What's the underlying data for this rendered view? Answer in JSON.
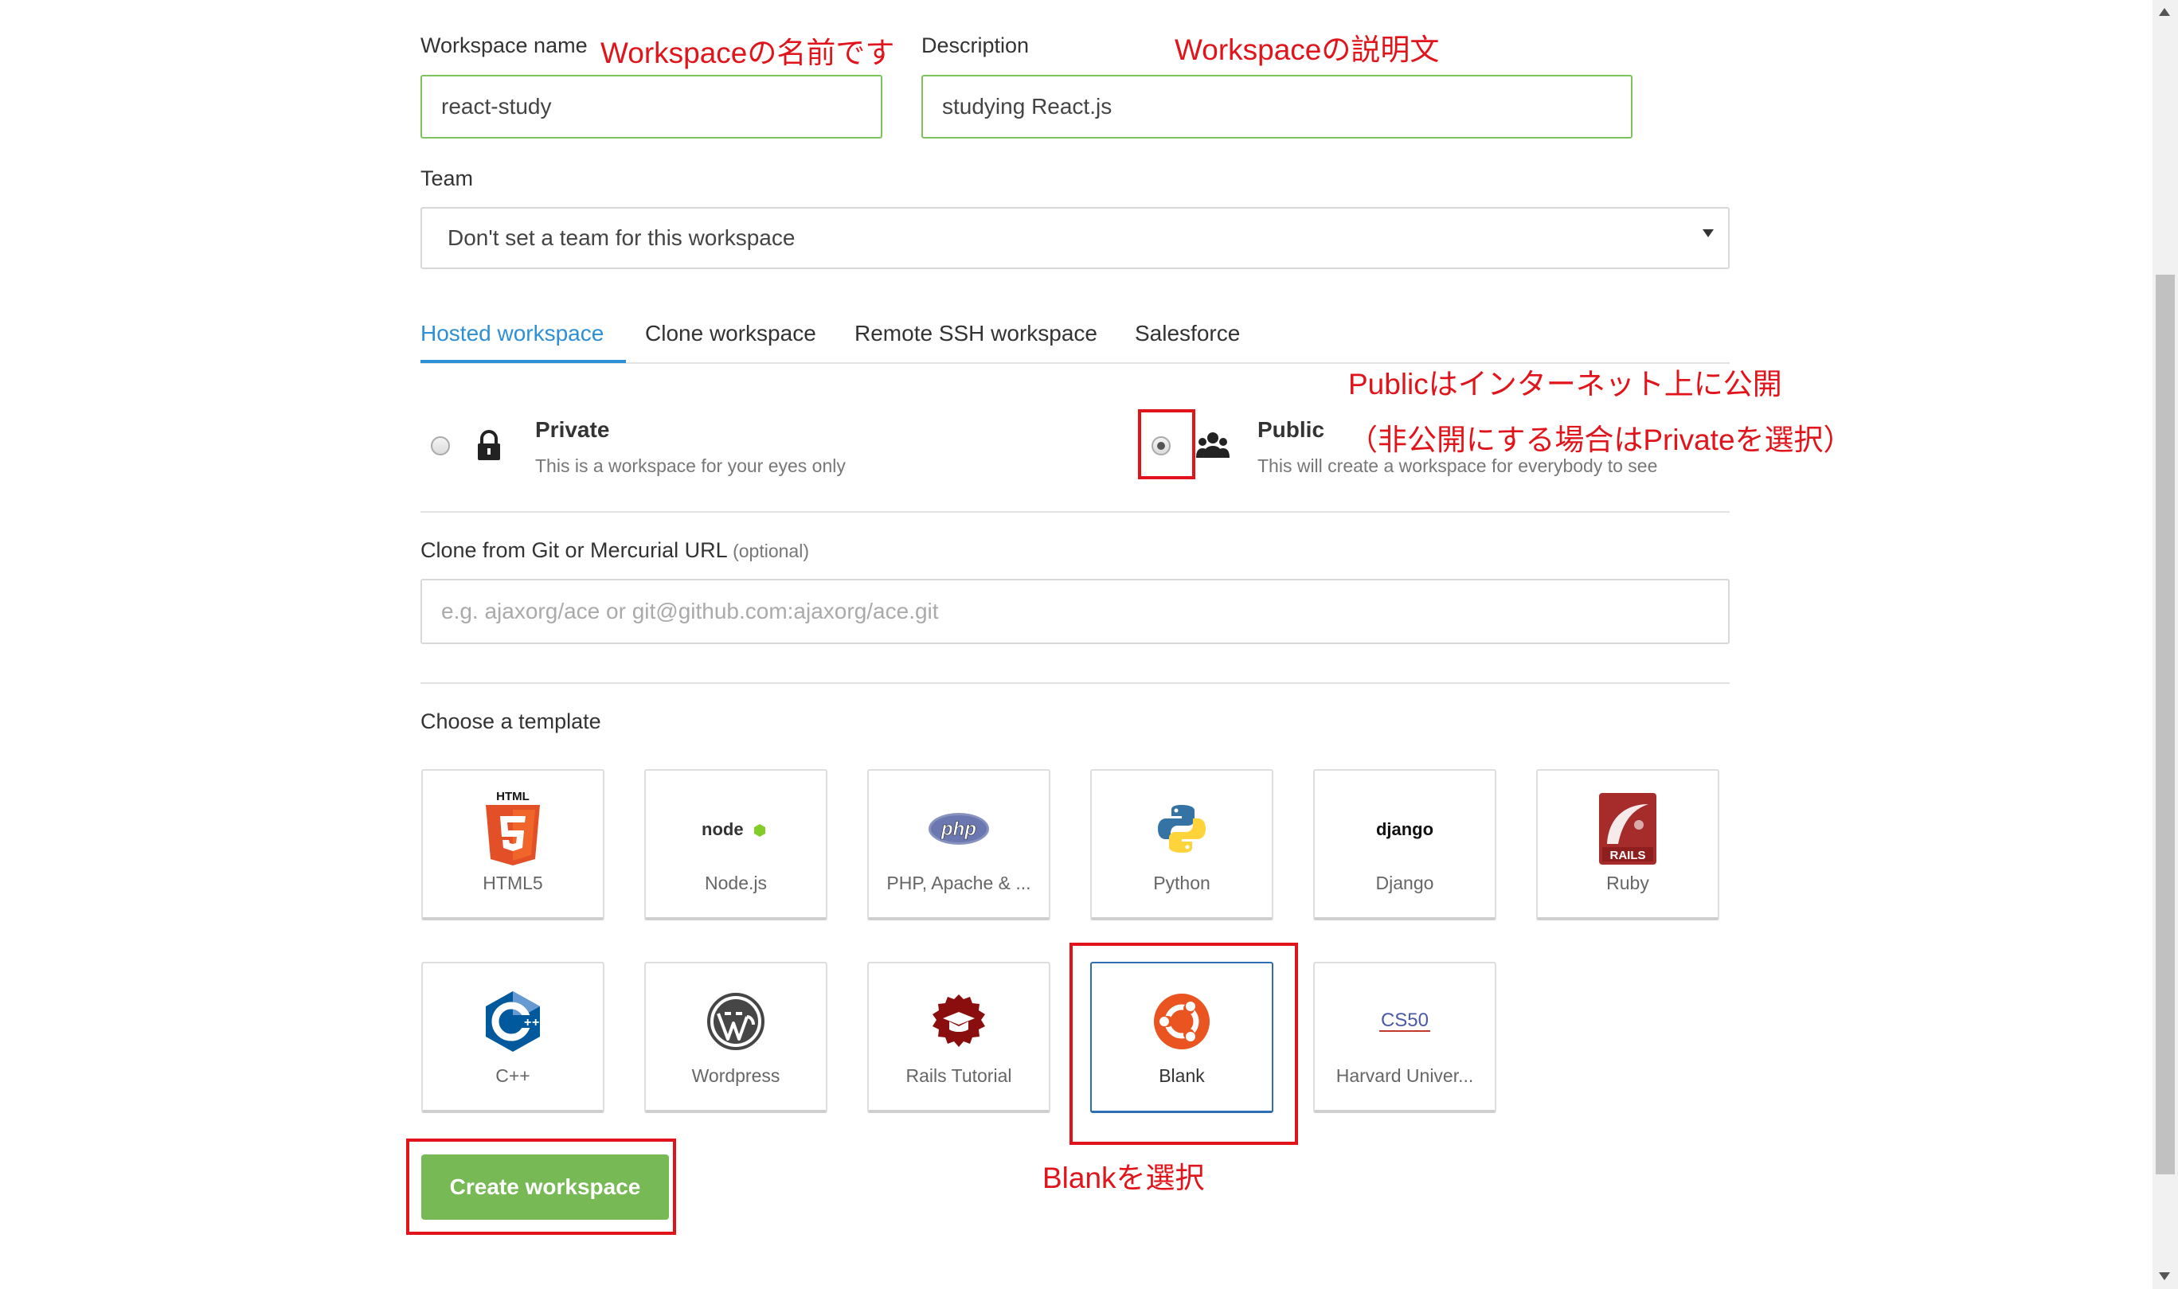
{
  "form": {
    "workspace_name_label": "Workspace name",
    "workspace_name_value": "react-study",
    "description_label": "Description",
    "description_value": "studying React.js",
    "team_label": "Team",
    "team_selected": "Don't set a team for this workspace"
  },
  "tabs": [
    {
      "label": "Hosted workspace",
      "active": true
    },
    {
      "label": "Clone workspace",
      "active": false
    },
    {
      "label": "Remote SSH workspace",
      "active": false
    },
    {
      "label": "Salesforce",
      "active": false
    }
  ],
  "visibility": {
    "private": {
      "title": "Private",
      "subtitle": "This is a workspace for your eyes only",
      "icon": "lock-icon",
      "checked": false
    },
    "public": {
      "title": "Public",
      "subtitle": "This will create a workspace for everybody to see",
      "icon": "users-icon",
      "checked": true
    }
  },
  "clone": {
    "label": "Clone from Git or Mercurial URL",
    "optional": "(optional)",
    "placeholder": "e.g. ajaxorg/ace or git@github.com:ajaxorg/ace.git"
  },
  "templates": {
    "label": "Choose a template",
    "items": [
      {
        "name": "HTML5",
        "icon": "html5-logo-icon",
        "logo_text": "HTML"
      },
      {
        "name": "Node.js",
        "icon": "nodejs-logo-icon",
        "logo_text": "node"
      },
      {
        "name": "PHP, Apache & ...",
        "icon": "php-logo-icon",
        "logo_text": "php"
      },
      {
        "name": "Python",
        "icon": "python-logo-icon"
      },
      {
        "name": "Django",
        "icon": "django-logo-icon",
        "logo_text": "django"
      },
      {
        "name": "Ruby",
        "icon": "rails-logo-icon",
        "logo_text": "RAILS"
      },
      {
        "name": "C++",
        "icon": "cpp-logo-icon"
      },
      {
        "name": "Wordpress",
        "icon": "wordpress-logo-icon"
      },
      {
        "name": "Rails Tutorial",
        "icon": "rails-tutorial-logo-icon"
      },
      {
        "name": "Blank",
        "icon": "ubuntu-logo-icon",
        "selected": true
      },
      {
        "name": "Harvard Univer...",
        "icon": "cs50-logo-icon",
        "logo_text": "CS50"
      }
    ]
  },
  "create_button": "Create workspace",
  "annotations": {
    "name_note": "Workspaceの名前です",
    "description_note": "Workspaceの説明文",
    "public_note_1": "Publicはインターネット上に公開",
    "public_note_2": "（非公開にする場合はPrivateを選択）",
    "blank_note": "Blankを選択"
  },
  "colors": {
    "accent_blue": "#2d8fd6",
    "button_green": "#77b955",
    "input_border_green": "#7dc35b",
    "annotation_red": "#e0141a"
  }
}
